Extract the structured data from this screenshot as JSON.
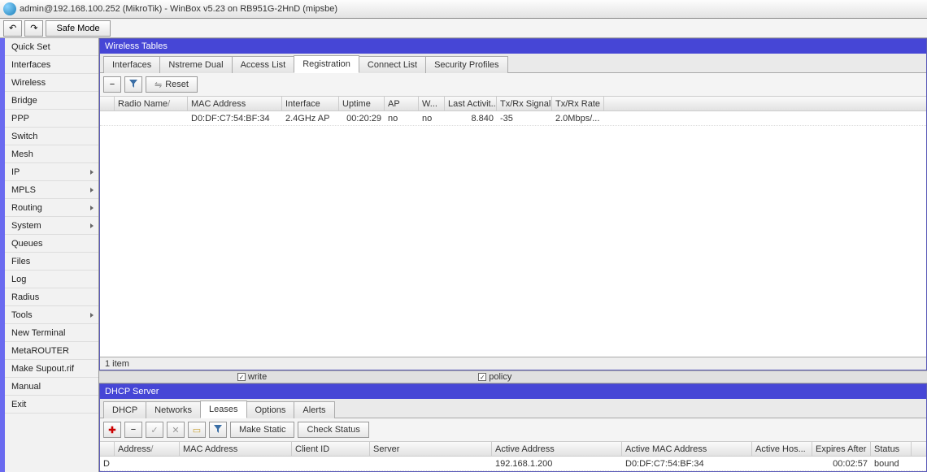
{
  "title": "admin@192.168.100.252 (MikroTik) - WinBox v5.23 on RB951G-2HnD (mipsbe)",
  "toolbar": {
    "safe_mode": "Safe Mode"
  },
  "sidebar": {
    "items": [
      {
        "label": "Quick Set",
        "sub": false
      },
      {
        "label": "Interfaces",
        "sub": false
      },
      {
        "label": "Wireless",
        "sub": false
      },
      {
        "label": "Bridge",
        "sub": false
      },
      {
        "label": "PPP",
        "sub": false
      },
      {
        "label": "Switch",
        "sub": false
      },
      {
        "label": "Mesh",
        "sub": false
      },
      {
        "label": "IP",
        "sub": true
      },
      {
        "label": "MPLS",
        "sub": true
      },
      {
        "label": "Routing",
        "sub": true
      },
      {
        "label": "System",
        "sub": true
      },
      {
        "label": "Queues",
        "sub": false
      },
      {
        "label": "Files",
        "sub": false
      },
      {
        "label": "Log",
        "sub": false
      },
      {
        "label": "Radius",
        "sub": false
      },
      {
        "label": "Tools",
        "sub": true
      },
      {
        "label": "New Terminal",
        "sub": false
      },
      {
        "label": "MetaROUTER",
        "sub": false
      },
      {
        "label": "Make Supout.rif",
        "sub": false
      },
      {
        "label": "Manual",
        "sub": false
      },
      {
        "label": "Exit",
        "sub": false
      }
    ]
  },
  "wireless": {
    "title": "Wireless Tables",
    "tabs": [
      "Interfaces",
      "Nstreme Dual",
      "Access List",
      "Registration",
      "Connect List",
      "Security Profiles"
    ],
    "reset": "Reset",
    "headers": [
      "",
      "Radio Name",
      "MAC Address",
      "Interface",
      "Uptime",
      "AP",
      "W...",
      "Last Activit...",
      "Tx/Rx Signal ...",
      "Tx/Rx Rate"
    ],
    "row": {
      "radio_name": "",
      "mac": "D0:DF:C7:54:BF:34",
      "iface": "2.4GHz AP",
      "uptime": "00:20:29",
      "ap": "no",
      "w": "no",
      "last": "8.840",
      "signal": "-35",
      "rate": "2.0Mbps/..."
    },
    "status": "1 item"
  },
  "hiddenbar": {
    "write": "write",
    "policy": "policy"
  },
  "dhcp": {
    "title": "DHCP Server",
    "tabs": [
      "DHCP",
      "Networks",
      "Leases",
      "Options",
      "Alerts"
    ],
    "make_static": "Make Static",
    "check_status": "Check Status",
    "headers": [
      "",
      "Address",
      "MAC Address",
      "Client ID",
      "Server",
      "Active Address",
      "Active MAC Address",
      "Active Hos...",
      "Expires After",
      "Status"
    ],
    "row": {
      "flag": "D",
      "address": "",
      "mac": "",
      "client_id": "",
      "server": "",
      "active_addr": "192.168.1.200",
      "active_mac": "D0:DF:C7:54:BF:34",
      "active_host": "",
      "expires": "00:02:57",
      "status": "bound"
    }
  }
}
